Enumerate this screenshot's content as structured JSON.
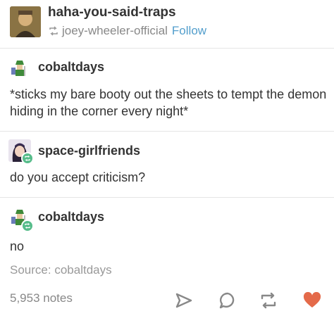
{
  "header": {
    "username": "haha-you-said-traps",
    "reblogged_from": "joey-wheeler-official",
    "follow_label": "Follow"
  },
  "posts": [
    {
      "username": "cobaltdays",
      "text": "*sticks my bare booty out the sheets to tempt the demon hiding in the corner every night*"
    },
    {
      "username": "space-girlfriends",
      "text": "do you accept criticism?"
    },
    {
      "username": "cobaltdays",
      "text": "no"
    }
  ],
  "source": {
    "label": "Source:",
    "name": "cobaltdays"
  },
  "footer": {
    "notes": "5,953 notes"
  },
  "colors": {
    "follow": "#529ecc",
    "reblog_badge": "#56bc8a",
    "heart": "#e46a4a"
  },
  "icons": [
    "reblog-icon",
    "share-icon",
    "reply-icon",
    "reblog-icon",
    "heart-icon"
  ]
}
